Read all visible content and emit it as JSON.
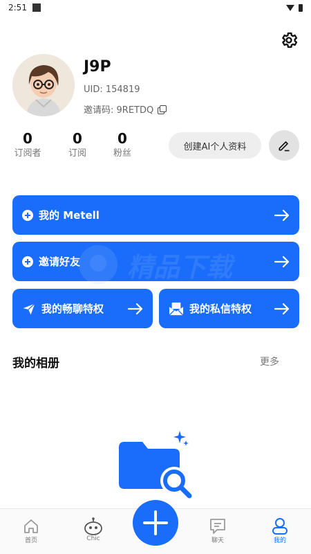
{
  "status_bar": {
    "time": "2:51"
  },
  "profile": {
    "username": "J9P",
    "uid_text": "UID: 154819",
    "invite_text": "邀请码: 9RETDQ"
  },
  "stats": [
    {
      "value": "0",
      "label": "订阅者"
    },
    {
      "value": "0",
      "label": "订阅"
    },
    {
      "value": "0",
      "label": "粉丝"
    }
  ],
  "actions": {
    "create_ai_label": "创建AI个人资料"
  },
  "cards": {
    "my_metell": "我的 Metell",
    "invite_friends": "邀请好友",
    "chat_privilege": "我的畅聊特权",
    "message_privilege": "我的私信特权"
  },
  "watermark": {
    "text": "精品下载"
  },
  "album": {
    "title": "我的相册",
    "more": "更多"
  },
  "bottom_nav": {
    "home": "首页",
    "chic": "Chic",
    "chat": "聊天",
    "mine": "我的"
  },
  "colors": {
    "accent": "#1a6dfa",
    "card_text": "#ffffff"
  }
}
